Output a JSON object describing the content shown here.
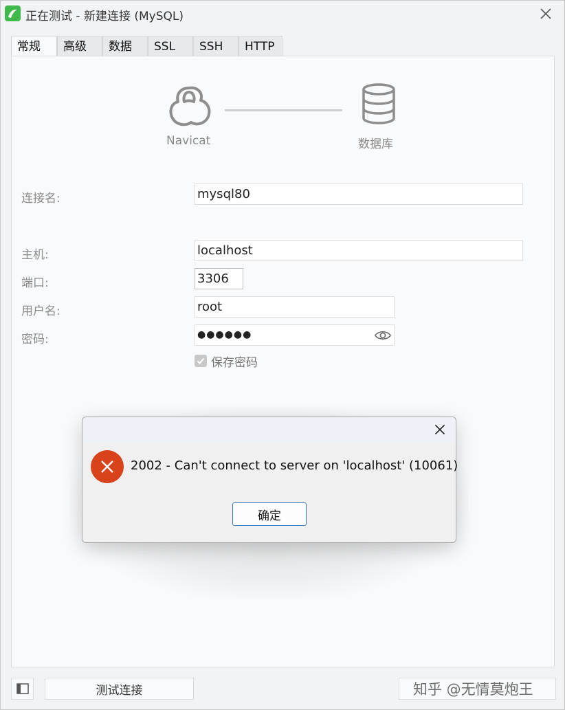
{
  "window": {
    "title": "正在测试 - 新建连接 (MySQL)"
  },
  "tabs": [
    {
      "label": "常规",
      "active": true
    },
    {
      "label": "高级"
    },
    {
      "label": "数据库"
    },
    {
      "label": "SSL"
    },
    {
      "label": "SSH"
    },
    {
      "label": "HTTP"
    }
  ],
  "diagram": {
    "left_label": "Navicat",
    "right_label": "数据库"
  },
  "form": {
    "connection_name_label": "连接名:",
    "connection_name_value": "mysql80",
    "host_label": "主机:",
    "host_value": "localhost",
    "port_label": "端口:",
    "port_value": "3306",
    "username_label": "用户名:",
    "username_value": "root",
    "password_label": "密码:",
    "password_value": "●●●●●●",
    "save_password_label": "保存密码",
    "save_password_checked": true
  },
  "bottom": {
    "test_button": "测试连接",
    "watermark": "知乎 @无情莫炮王"
  },
  "dialog": {
    "message": "2002 - Can't connect to server on 'localhost' (10061)",
    "ok_button": "确定",
    "error_color": "#d8431c"
  },
  "colors": {
    "accent_green": "#3fba4a",
    "button_border": "#3b78c4"
  }
}
